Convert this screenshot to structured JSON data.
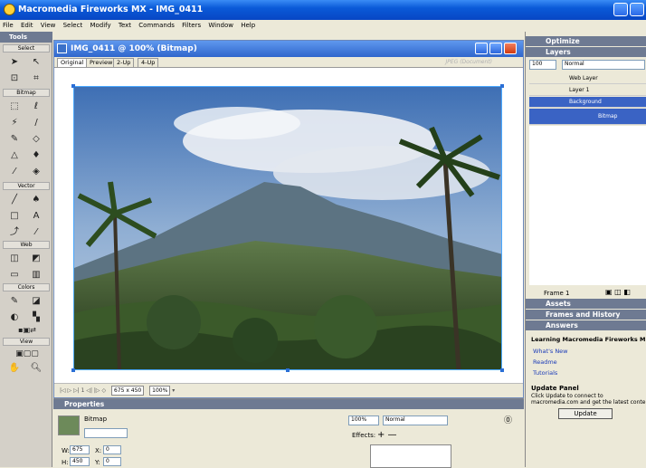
{
  "app": {
    "title": "Macromedia Fireworks MX - IMG_0411"
  },
  "menu": [
    "File",
    "Edit",
    "View",
    "Select",
    "Modify",
    "Text",
    "Commands",
    "Filters",
    "Window",
    "Help"
  ],
  "tools": {
    "header": "Tools",
    "sections": [
      "Select",
      "Bitmap",
      "Vector",
      "Web",
      "Colors",
      "View"
    ]
  },
  "document": {
    "title": "IMG_0411 @ 100% (Bitmap)",
    "tabs": [
      "Original",
      "Preview",
      "2-Up",
      "4-Up"
    ],
    "active_tab": "Original",
    "format_label": "JPEG (Document)",
    "status": {
      "frame": "1",
      "size": "675 x 450",
      "zoom": "100%"
    }
  },
  "properties": {
    "header": "Properties",
    "object_type": "Bitmap",
    "name_value": "",
    "w": "675",
    "h": "450",
    "x": "0",
    "y": "0",
    "opacity": "100%",
    "blend": "Normal",
    "effects_label": "Effects:"
  },
  "panels": {
    "optimize": "Optimize",
    "layers": {
      "header": "Layers",
      "opacity": "100",
      "blend": "Normal",
      "rows": [
        "Web Layer",
        "Layer 1",
        "Background",
        "Bitmap"
      ],
      "frame": "Frame 1"
    },
    "assets": "Assets",
    "frames_history": "Frames and History",
    "answers": {
      "header": "Answers",
      "title": "Learning Macromedia Fireworks M",
      "links": [
        "What's New",
        "Readme",
        "Tutorials"
      ],
      "update_title": "Update Panel",
      "update_text_1": "Click Update to connect to",
      "update_text_2": "macromedia.com and get the latest conte",
      "update_button": "Update"
    }
  },
  "colors": {
    "title_blue": "#0a5ad8",
    "panel_header": "#6e7a92",
    "selection": "#3a63c4"
  }
}
